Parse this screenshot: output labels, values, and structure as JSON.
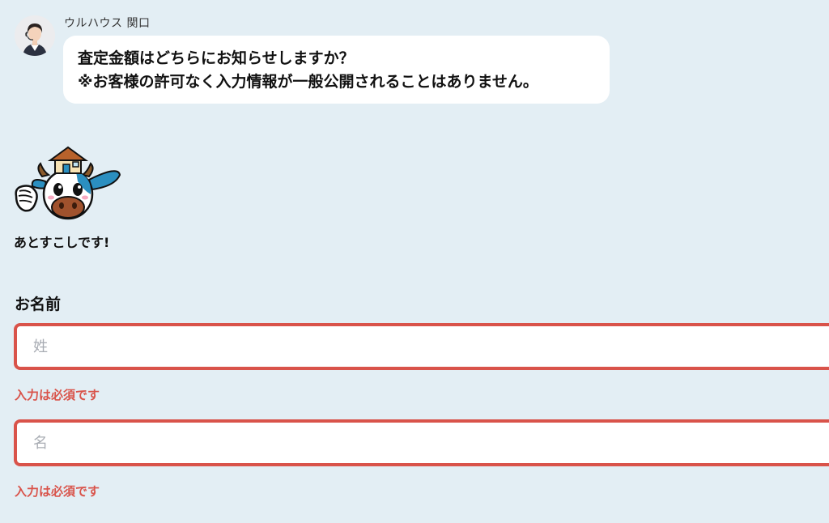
{
  "operator": {
    "name": "ウルハウス 関口",
    "message_lines": [
      "査定金額はどちらにお知らせしますか？",
      "※お客様の許可なく入力情報が一般公開されることはありません。"
    ]
  },
  "mascot": {
    "caption": "あとすこしです!"
  },
  "form": {
    "name_label": "お名前",
    "last_name": {
      "value": "",
      "placeholder": "姓",
      "error": "入力は必須です"
    },
    "first_name": {
      "value": "",
      "placeholder": "名",
      "error": "入力は必須です"
    }
  },
  "colors": {
    "background": "#e3eef4",
    "error": "#d9534a",
    "bubble": "#ffffff"
  }
}
